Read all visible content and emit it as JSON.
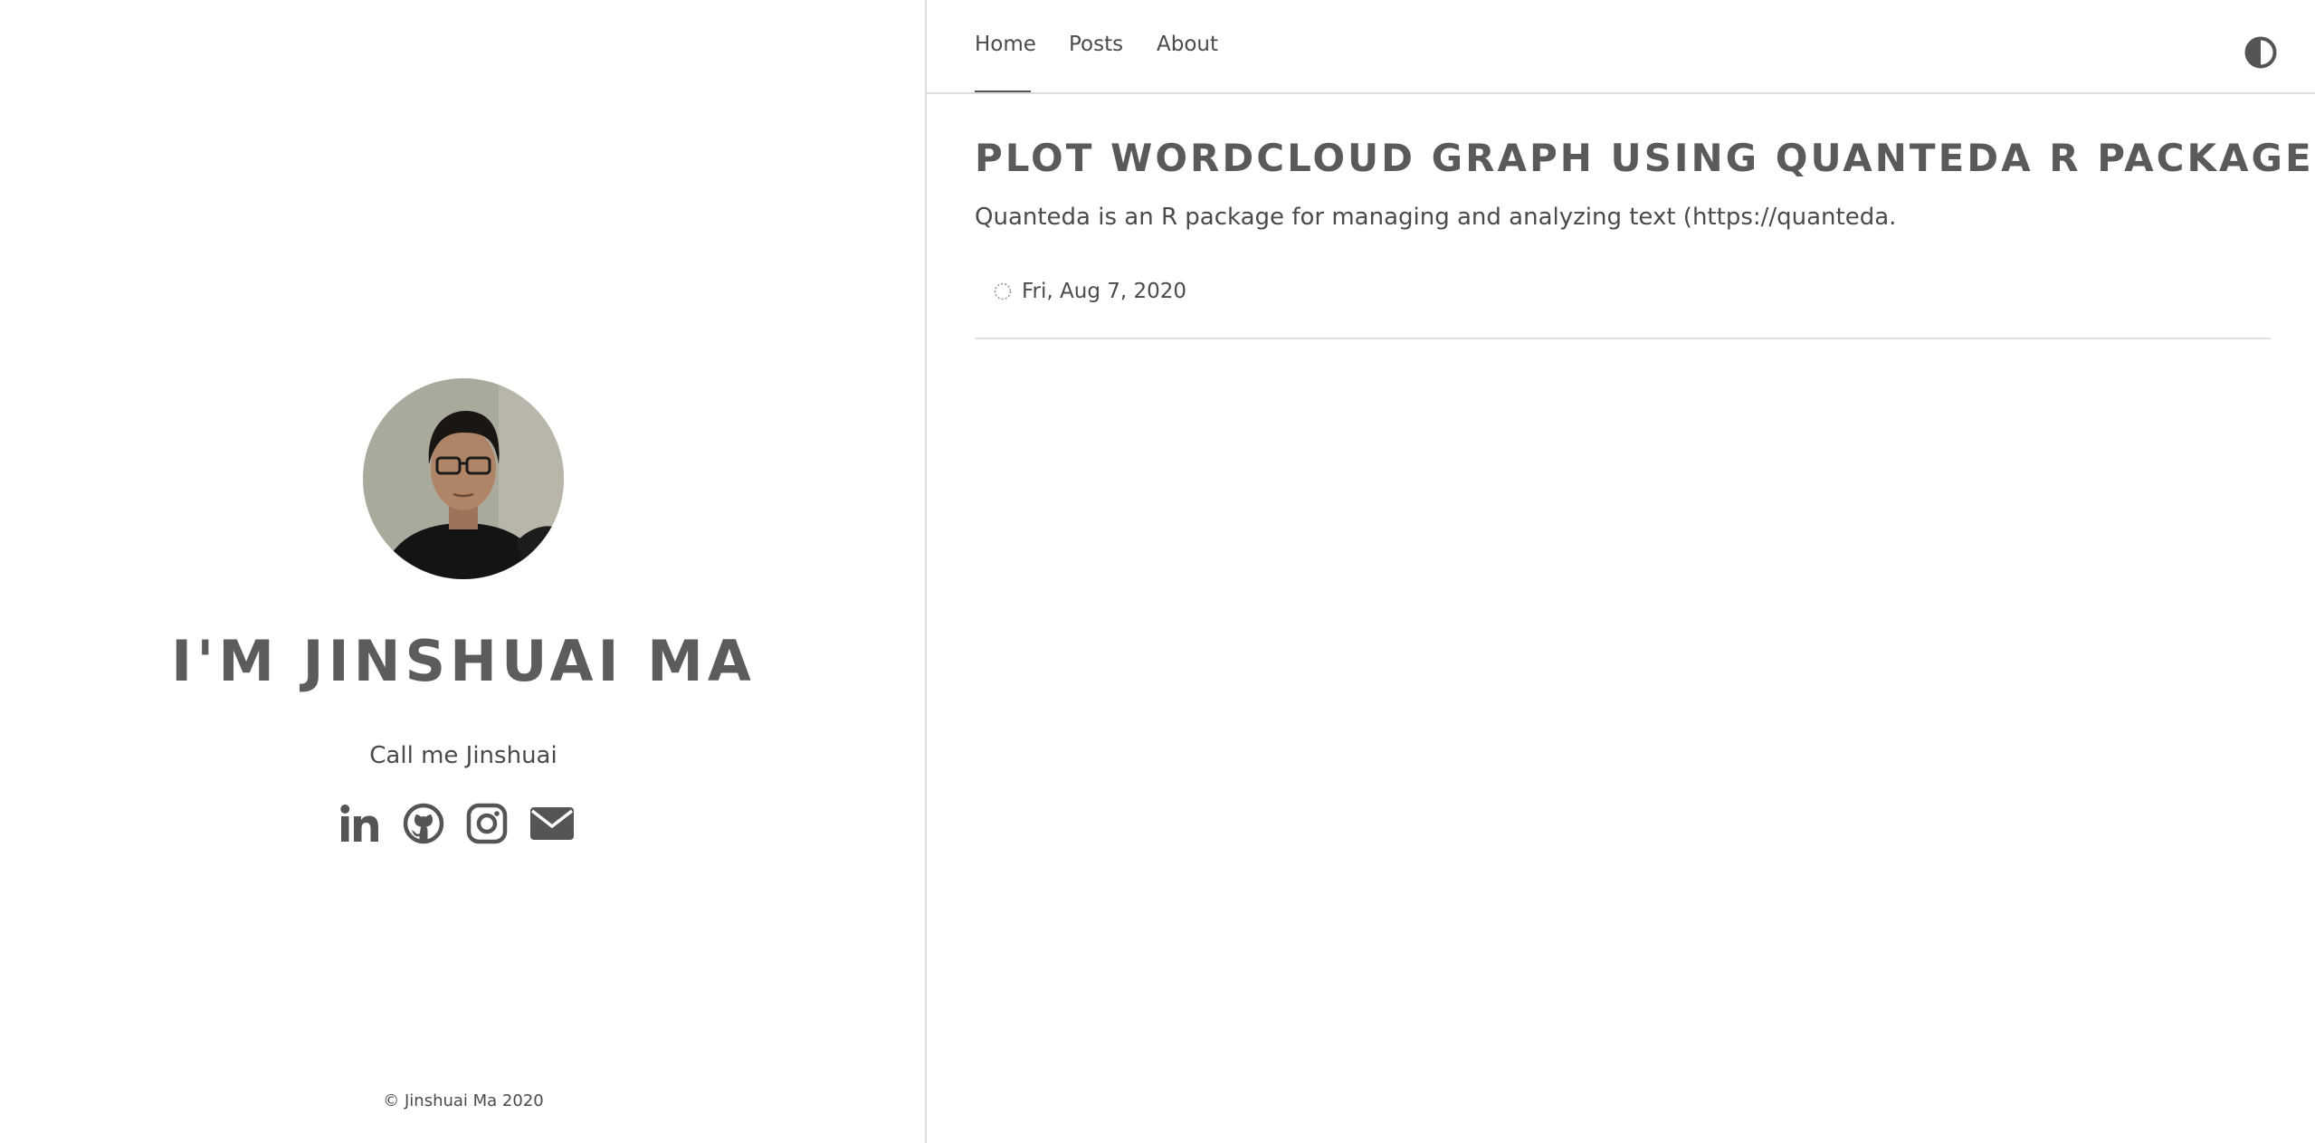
{
  "profile": {
    "name": "I'M JINSHUAI MA",
    "tagline": "Call me Jinshuai",
    "avatar_icon": "avatar-photo",
    "social": [
      {
        "icon": "linkedin-icon"
      },
      {
        "icon": "github-icon"
      },
      {
        "icon": "instagram-icon"
      },
      {
        "icon": "email-icon"
      }
    ],
    "copyright": "© Jinshuai Ma 2020"
  },
  "nav": {
    "items": [
      {
        "label": "Home",
        "active": true
      },
      {
        "label": "Posts",
        "active": false
      },
      {
        "label": "About",
        "active": false
      }
    ],
    "theme_toggle_icon": "half-circle-contrast-icon"
  },
  "posts": [
    {
      "title": "PLOT WORDCLOUD GRAPH USING QUANTEDA R PACKAGE",
      "summary": "Quanteda is an R package for managing and analyzing text (https://quanteda.",
      "date": "Fri, Aug 7, 2020",
      "date_icon": "clock-icon"
    }
  ],
  "colors": {
    "text": "#555555",
    "divider": "#dcdcdc",
    "background": "#ffffff"
  }
}
